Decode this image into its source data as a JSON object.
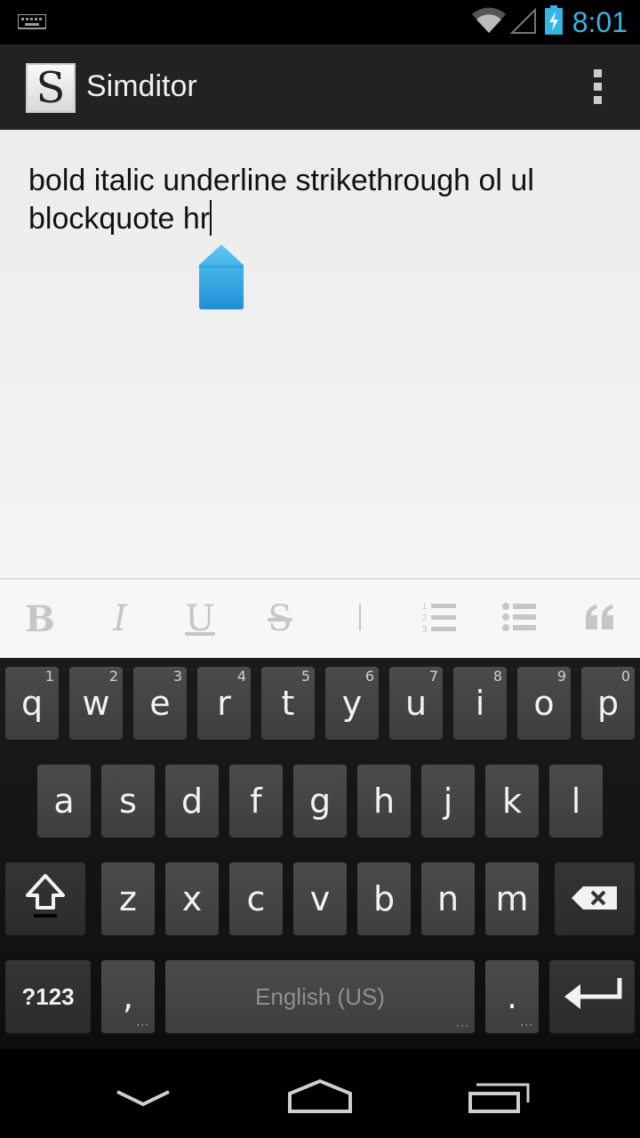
{
  "status_bar": {
    "time": "8:01",
    "accent_color": "#33b5e5"
  },
  "action_bar": {
    "logo_letter": "S",
    "title": "Simditor",
    "overflow_icon": "overflow-menu-icon"
  },
  "editor": {
    "text": "bold italic underline strikethrough ol ul blockquote hr"
  },
  "toolbar": {
    "bold_label": "B",
    "italic_label": "I",
    "underline_label": "U",
    "strike_label": "S",
    "icons": [
      "bold-icon",
      "italic-icon",
      "underline-icon",
      "strikethrough-icon",
      "hr-icon",
      "ordered-list-icon",
      "unordered-list-icon",
      "blockquote-icon"
    ]
  },
  "keyboard": {
    "row1": [
      {
        "label": "q",
        "hint": "1"
      },
      {
        "label": "w",
        "hint": "2"
      },
      {
        "label": "e",
        "hint": "3"
      },
      {
        "label": "r",
        "hint": "4"
      },
      {
        "label": "t",
        "hint": "5"
      },
      {
        "label": "y",
        "hint": "6"
      },
      {
        "label": "u",
        "hint": "7"
      },
      {
        "label": "i",
        "hint": "8"
      },
      {
        "label": "o",
        "hint": "9"
      },
      {
        "label": "p",
        "hint": "0"
      }
    ],
    "row2": [
      "a",
      "s",
      "d",
      "f",
      "g",
      "h",
      "j",
      "k",
      "l"
    ],
    "row3": [
      "z",
      "x",
      "c",
      "v",
      "b",
      "n",
      "m"
    ],
    "symbols_label": "?123",
    "comma_label": ",",
    "space_label": "English (US)",
    "period_label": "."
  }
}
